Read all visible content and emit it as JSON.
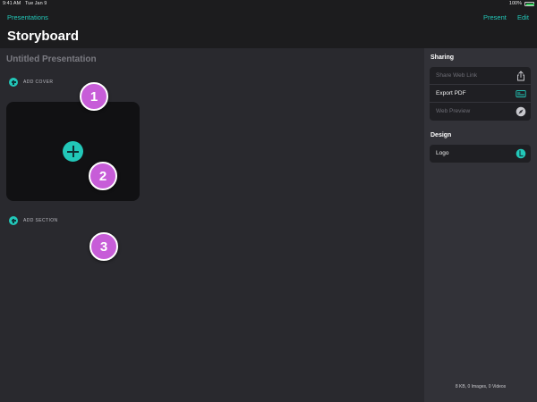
{
  "status_bar": {
    "time": "9:41 AM",
    "date": "Tue Jan 9",
    "battery_text": "100%",
    "battery_level": 1.0,
    "battery_color": "#30d158"
  },
  "nav": {
    "back_label": "Presentations",
    "present_label": "Present",
    "edit_label": "Edit",
    "accent": "#22c7b8"
  },
  "page": {
    "title": "Storyboard"
  },
  "main": {
    "presentation_title": "Untitled Presentation",
    "add_cover_label": "ADD COVER",
    "add_section_label": "ADD SECTION",
    "add_icon": "plus-circle-icon"
  },
  "badges": [
    "1",
    "2",
    "3"
  ],
  "sidebar": {
    "sharing_heading": "Sharing",
    "sharing_items": [
      {
        "label": "Share Web Link",
        "icon": "share-icon",
        "enabled": false
      },
      {
        "label": "Export PDF",
        "icon": "pdf-icon",
        "enabled": true
      },
      {
        "label": "Web Preview",
        "icon": "compass-icon",
        "enabled": false
      }
    ],
    "design_heading": "Design",
    "design_items": [
      {
        "label": "Logo",
        "icon": "logo-icon",
        "enabled": true
      }
    ],
    "footer": "8 KB, 0 Images, 0 Videos"
  }
}
